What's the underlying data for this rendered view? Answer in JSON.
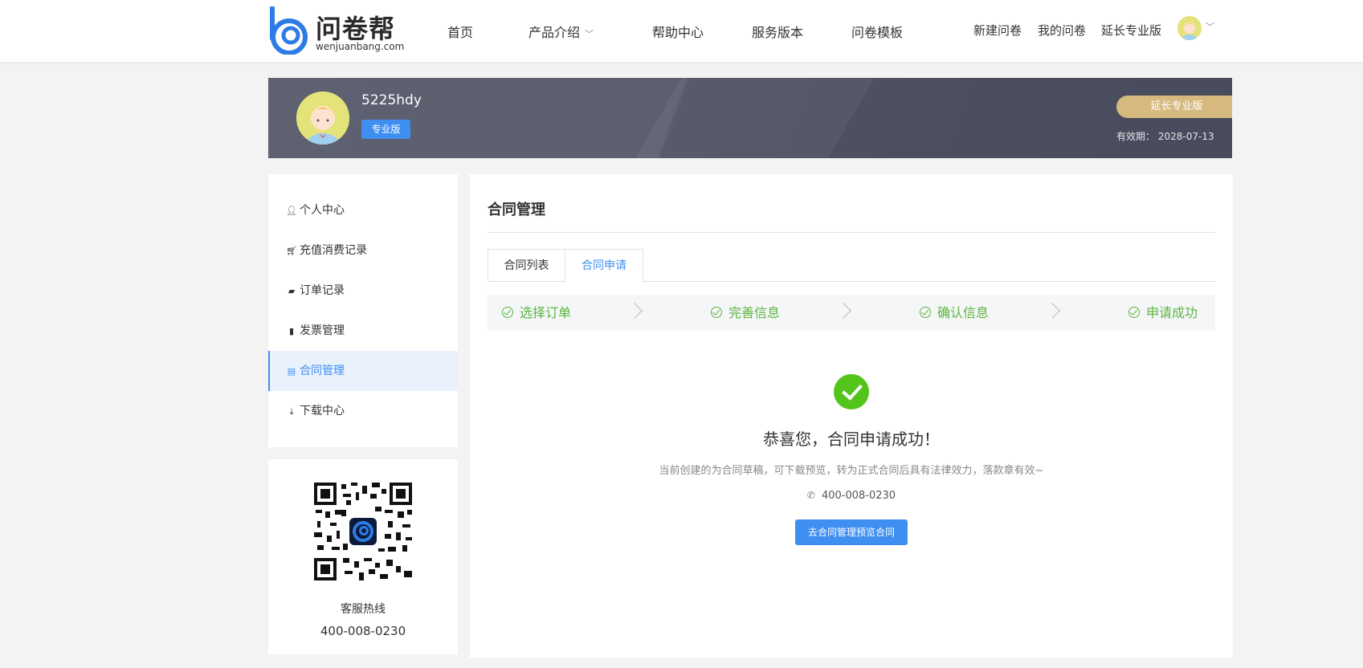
{
  "header": {
    "logo_text": "问卷帮",
    "logo_sub": "wenjuanbang.com",
    "nav": [
      "首页",
      "产品介绍",
      "帮助中心",
      "服务版本",
      "问卷模板"
    ],
    "right_links": [
      "新建问卷",
      "我的问卷",
      "延长专业版"
    ]
  },
  "banner": {
    "username": "5225hdy",
    "badge": "专业版",
    "extend_button": "延长专业版",
    "validity_label": "有效期：",
    "validity_date": "2028-07-13"
  },
  "sidebar": {
    "items": [
      {
        "icon": "user-icon",
        "label": "个人中心"
      },
      {
        "icon": "cart-icon",
        "label": "充值消费记录"
      },
      {
        "icon": "ticket-icon",
        "label": "订单记录"
      },
      {
        "icon": "clipboard-icon",
        "label": "发票管理"
      },
      {
        "icon": "document-icon",
        "label": "合同管理"
      },
      {
        "icon": "download-icon",
        "label": "下载中心"
      }
    ],
    "active": "合同管理"
  },
  "qr_card": {
    "label": "客服热线",
    "phone": "400-008-0230"
  },
  "main": {
    "title": "合同管理",
    "tabs": [
      "合同列表",
      "合同申请"
    ],
    "active_tab": "合同申请",
    "steps": [
      "选择订单",
      "完善信息",
      "确认信息",
      "申请成功"
    ],
    "success_title": "恭喜您，合同申请成功！",
    "success_desc": "当前创建的为合同草稿，可下载预览，转为正式合同后具有法律效力，落款章有效~",
    "phone": "400-008-0230",
    "preview_button": "去合同管理预览合同"
  },
  "colors": {
    "accent": "#3f8ff0",
    "success": "#52c41a",
    "step_green": "#5bb53e",
    "gold": "#d6b97f"
  }
}
